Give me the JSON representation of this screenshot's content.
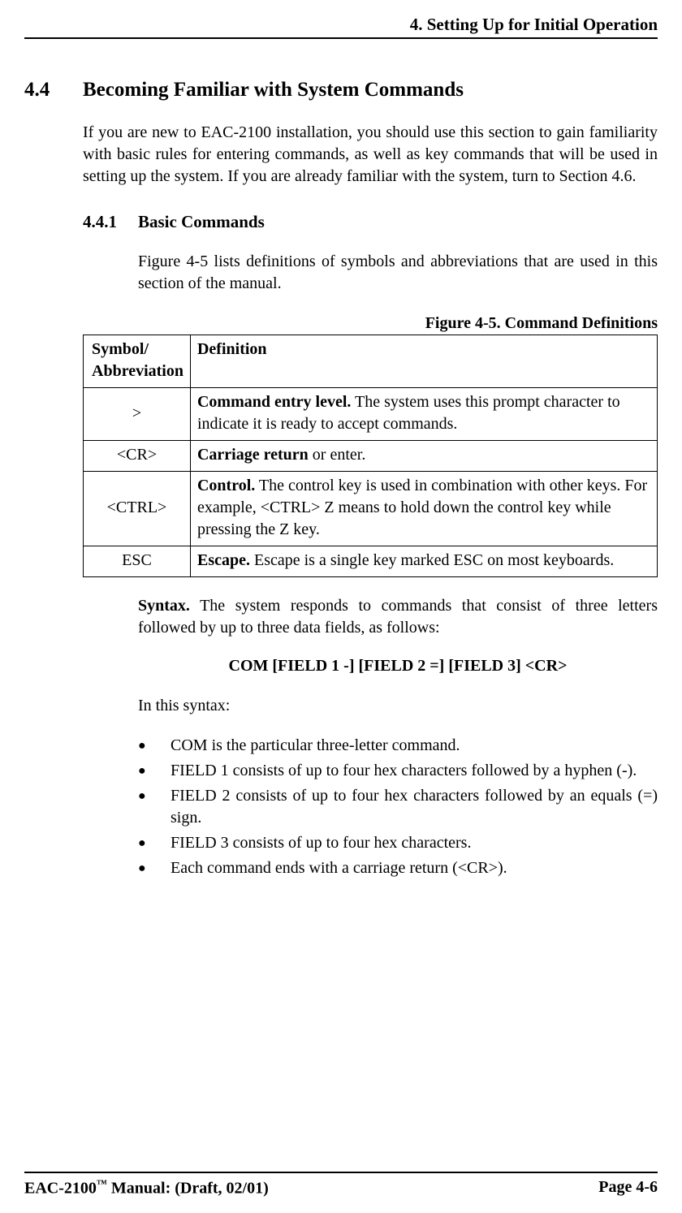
{
  "header": {
    "chapter_title": "4. Setting Up for Initial Operation"
  },
  "section": {
    "number": "4.4",
    "title": "Becoming Familiar with System Commands",
    "intro": "If you are new to EAC-2100 installation, you should use this section to gain familiarity with basic rules for entering commands, as well as key commands that will be used in setting up the system. If you are already familiar with the system, turn to Section 4.6."
  },
  "subsection": {
    "number": "4.4.1",
    "title": "Basic Commands",
    "intro": "Figure 4-5 lists definitions of symbols and abbreviations that are  used in this section of the manual."
  },
  "figure_caption": "Figure 4-5. Command Definitions",
  "table": {
    "col1_header_1": "Symbol/",
    "col1_header_2": "Abbreviation",
    "col2_header": "Definition",
    "rows": [
      {
        "symbol": ">",
        "def_bold": "Command entry level.",
        "def_rest": " The system uses this prompt character to indicate it is ready to accept commands."
      },
      {
        "symbol": "<CR>",
        "def_bold": "Carriage return",
        "def_rest": " or enter."
      },
      {
        "symbol": "<CTRL>",
        "def_bold": "Control.",
        "def_rest": " The control key is used in combination with other keys. For example, <CTRL> Z means to hold down the control key while pressing the Z key."
      },
      {
        "symbol": "ESC",
        "def_bold": "Escape.",
        "def_rest": " Escape is a single key marked ESC on most keyboards."
      }
    ]
  },
  "syntax": {
    "lead_bold": "Syntax.",
    "lead_rest": " The system responds to commands that consist of three letters followed by up to three data fields, as follows:",
    "format_line": "COM [FIELD 1 -] [FIELD 2 =] [FIELD 3] <CR>",
    "in_this": "In this syntax:",
    "bullets": [
      "COM is the particular three-letter command.",
      "FIELD 1 consists of up to four hex characters followed by a hyphen (-).",
      "FIELD 2 consists of up to four hex characters followed by an equals (=) sign.",
      "FIELD 3 consists of up to four hex characters.",
      "Each command ends with a carriage return (<CR>)."
    ]
  },
  "footer": {
    "left_prefix": "EAC-2100",
    "left_tm": "™",
    "left_suffix": " Manual: (Draft, 02/01)",
    "right": "Page 4-6"
  }
}
